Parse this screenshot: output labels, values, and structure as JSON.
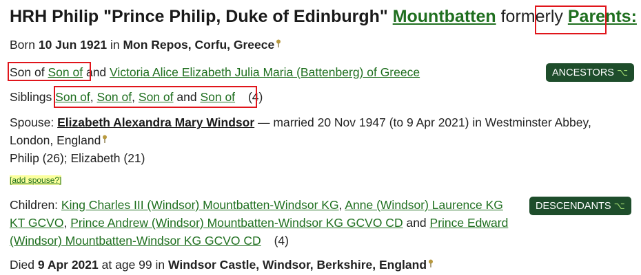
{
  "header": {
    "name": "HRH Philip \"Prince Philip, Duke of Edinburgh\"",
    "surname": "Mountbatten",
    "formerly": "formerly",
    "parents_label": "Parents:"
  },
  "birth": {
    "prefix": "Born",
    "date": "10 Jun 1921",
    "in": "in",
    "place": "Mon Repos, Corfu, Greece"
  },
  "parents": {
    "prefix": "Son of",
    "father": "Son of",
    "and": "and",
    "mother": "Victoria Alice Elizabeth Julia Maria (Battenberg) of Greece",
    "ancestors_button": "ANCESTORS"
  },
  "siblings": {
    "prefix": "Siblings",
    "items": [
      "Son of",
      "Son of",
      "Son of",
      "Son of"
    ],
    "comma": ",",
    "and": "and",
    "count": "(4)"
  },
  "spouse": {
    "prefix": "Spouse:",
    "name": "Elizabeth Alexandra Mary Windsor",
    "details_1": "— married 20 Nov 1947 (to 9 Apr 2021) in Westminster Abbey,",
    "details_2": "London, England",
    "ages": "Philip (26); Elizabeth (21)",
    "add_spouse": "[add spouse?]"
  },
  "children": {
    "prefix": "Children:",
    "items": [
      "King Charles III (Windsor) Mountbatten-Windsor KG",
      "Anne (Windsor) Laurence KG",
      "KT GCVO",
      "Prince Andrew (Windsor) Mountbatten-Windsor KG GCVO CD",
      "Prince Edward",
      "(Windsor) Mountbatten-Windsor KG GCVO CD"
    ],
    "comma": ",",
    "and": "and",
    "count": "(4)",
    "descendants_button": "DESCENDANTS"
  },
  "death": {
    "prefix": "Died",
    "date": "9 Apr 2021",
    "age_text": "at age 99 in",
    "place": "Windsor Castle, Windsor, Berkshire, England"
  },
  "colors": {
    "link": "#1f6f1f",
    "button_bg": "#1e4d2b",
    "highlight_box": "#e0151b"
  },
  "icons": [
    "pin-icon",
    "tree-icon"
  ]
}
